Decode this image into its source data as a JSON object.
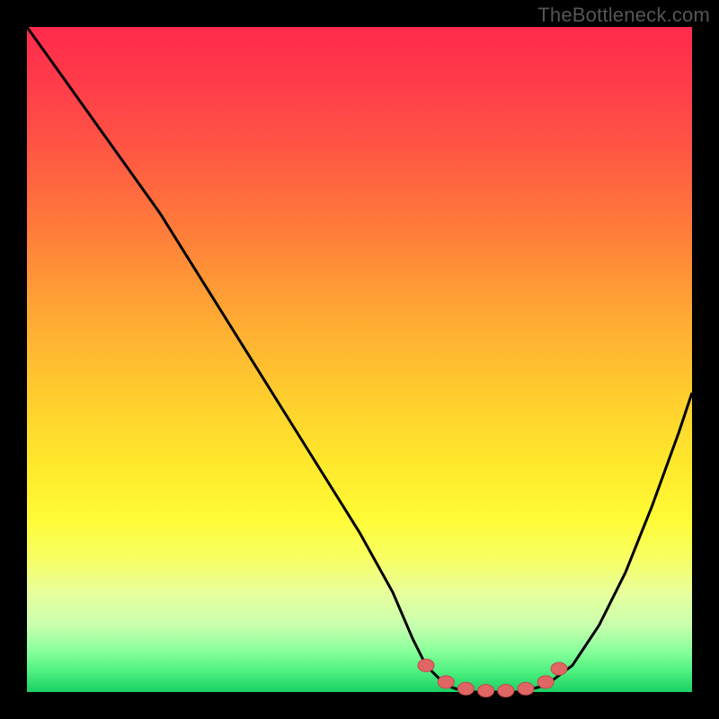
{
  "watermark": "TheBottleneck.com",
  "colors": {
    "background": "#000000",
    "curve_stroke": "#000000",
    "marker_fill": "#e06666",
    "marker_stroke": "#c44848"
  },
  "chart_data": {
    "type": "line",
    "title": "",
    "xlabel": "",
    "ylabel": "",
    "xlim": [
      0,
      100
    ],
    "ylim": [
      0,
      100
    ],
    "series": [
      {
        "name": "curve",
        "x": [
          0,
          5,
          10,
          15,
          20,
          25,
          30,
          35,
          40,
          45,
          50,
          55,
          58,
          60,
          63,
          66,
          70,
          74,
          78,
          82,
          86,
          90,
          94,
          98,
          100
        ],
        "y": [
          100,
          93,
          86,
          79,
          72,
          64,
          56,
          48,
          40,
          32,
          24,
          15,
          8,
          4,
          1,
          0,
          0,
          0,
          1,
          4,
          10,
          18,
          28,
          39,
          45
        ]
      }
    ],
    "markers": [
      {
        "x": 60,
        "y": 4
      },
      {
        "x": 63,
        "y": 1.5
      },
      {
        "x": 66,
        "y": 0.5
      },
      {
        "x": 69,
        "y": 0.2
      },
      {
        "x": 72,
        "y": 0.2
      },
      {
        "x": 75,
        "y": 0.5
      },
      {
        "x": 78,
        "y": 1.5
      },
      {
        "x": 80,
        "y": 3.5
      }
    ]
  }
}
